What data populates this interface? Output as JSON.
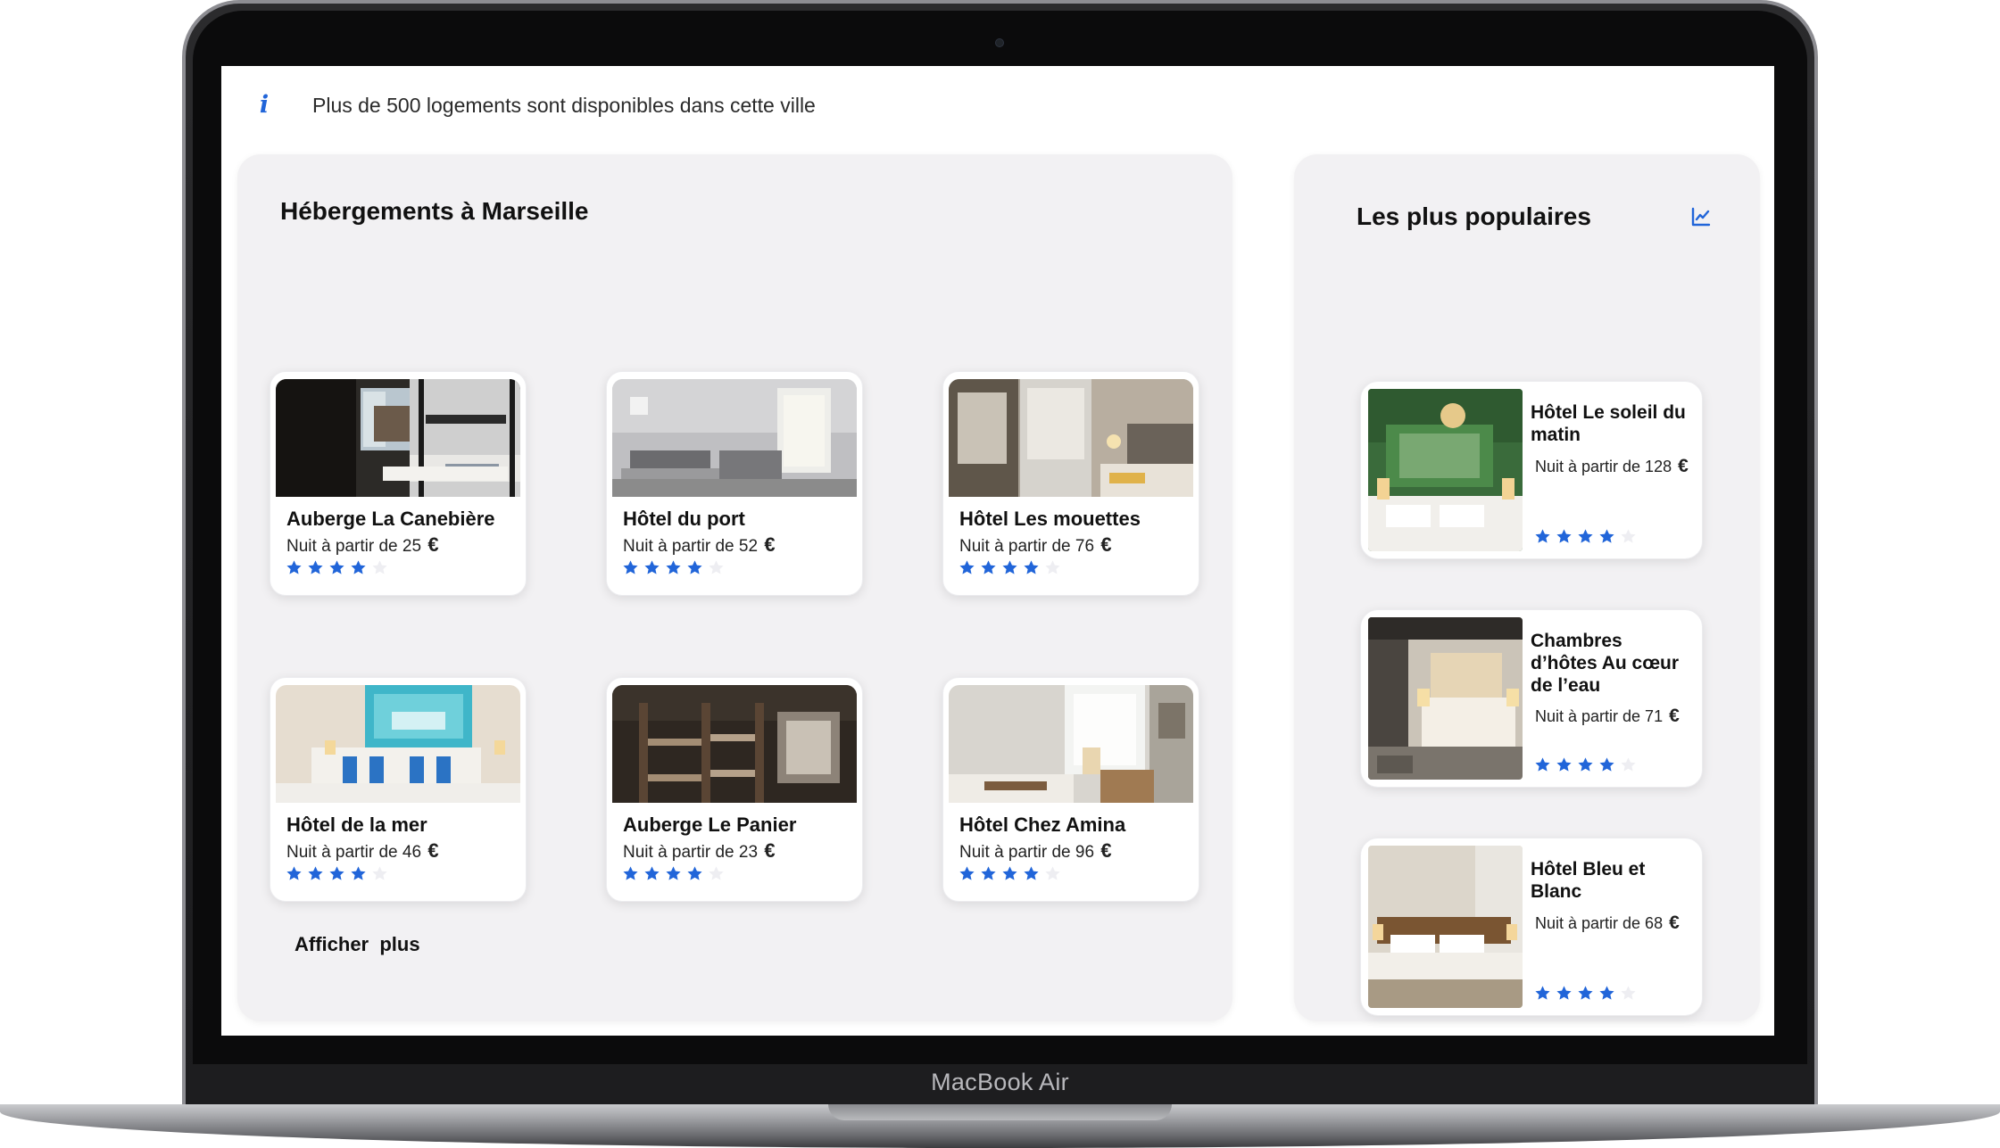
{
  "device": {
    "label": "MacBook Air"
  },
  "info_banner": {
    "icon": "info-icon",
    "text": "Plus de 500 logements sont disponibles dans cette ville"
  },
  "colors": {
    "accent": "#2165d9",
    "panel_bg": "#f2f1f3",
    "star_on": "#2165d9",
    "star_off": "#eeeef2"
  },
  "main": {
    "title": "Hébergements à Marseille",
    "more_label": "Afficher  plus",
    "hotels": [
      {
        "name": "Auberge La Canebière",
        "price_text": "Nuit à partir de 25",
        "currency": "€",
        "rating": 4,
        "rating_max": 5,
        "photo": "bunk-bed-room"
      },
      {
        "name": "Hôtel du port",
        "price_text": "Nuit à partir de 52",
        "currency": "€",
        "rating": 4,
        "rating_max": 5,
        "photo": "grey-twin-room"
      },
      {
        "name": "Hôtel Les mouettes",
        "price_text": "Nuit à partir de 76",
        "currency": "€",
        "rating": 4,
        "rating_max": 5,
        "photo": "wardrobe-room"
      },
      {
        "name": "Hôtel de la mer",
        "price_text": "Nuit à partir de 46",
        "currency": "€",
        "rating": 4,
        "rating_max": 5,
        "photo": "sea-painting-room"
      },
      {
        "name": "Auberge Le Panier",
        "price_text": "Nuit à partir de 23",
        "currency": "€",
        "rating": 4,
        "rating_max": 5,
        "photo": "dorm-bunks"
      },
      {
        "name": "Hôtel Chez Amina",
        "price_text": "Nuit à partir de 96",
        "currency": "€",
        "rating": 4,
        "rating_max": 5,
        "photo": "bright-room"
      }
    ]
  },
  "sidebar": {
    "title": "Les plus populaires",
    "icon": "trend-chart-icon",
    "hotels": [
      {
        "name": "Hôtel Le soleil du matin",
        "price_text": "Nuit à partir de 128",
        "currency": "€",
        "rating": 4,
        "rating_max": 5,
        "photo": "green-wall-room"
      },
      {
        "name": "Chambres d’hôtes Au cœur de l’eau",
        "price_text": "Nuit à partir de 71",
        "currency": "€",
        "rating": 4,
        "rating_max": 5,
        "photo": "beige-suite"
      },
      {
        "name": "Hôtel Bleu et Blanc",
        "price_text": "Nuit à partir de 68",
        "currency": "€",
        "rating": 4,
        "rating_max": 5,
        "photo": "wood-headboard-room"
      }
    ]
  }
}
